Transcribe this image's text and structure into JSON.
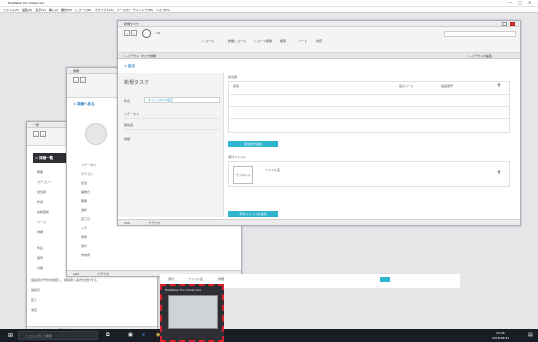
{
  "app": {
    "title": "FileMaker Pro Advanced",
    "window_controls": [
      "—",
      "□",
      "✕"
    ]
  },
  "menu": [
    "ファイル(F)",
    "編集(E)",
    "表示(V)",
    "挿入(I)",
    "書式(M)",
    "レコード(R)",
    "スクリプト(S)",
    "ツール(T)",
    "ウインドウ(W)",
    "ヘルプ(H)"
  ],
  "front": {
    "title": "新規タスク",
    "back": "< 戻る",
    "record_label": "1/1",
    "toolbar_items": [
      "レコード",
      "新規レコード",
      "レコード削除",
      "検索",
      "ソート",
      "共有"
    ],
    "fields": [
      {
        "label": "件名",
        "value": "オフィスWi-Fi設定"
      },
      {
        "label": "ステータス",
        "value": ""
      },
      {
        "label": "優先度",
        "value": ""
      },
      {
        "label": "詳細",
        "value": ""
      }
    ],
    "right_header": "担当者",
    "cols": [
      "名前",
      "電子メール",
      "電話番号"
    ],
    "add_person": "担当者を追加",
    "attach_header": "添付ファイル",
    "attach_thumb": "サムネイル",
    "file_name": "ファイル名",
    "add_file": "添付ファイルを追加",
    "zoom": "100",
    "mode": "ブラウズ",
    "layout_label": "レイアウト: タスク詳細",
    "layout_btn": "レイアウトの編集"
  },
  "mid": {
    "title": "詳細",
    "back": "< 詳細へ戻る",
    "items": [
      "ステータス",
      "カテゴリ",
      "担当",
      "開始日",
      "期限",
      "進捗",
      "完了日",
      "メモ",
      "場所",
      "添付",
      "作成者"
    ],
    "zoom": "100",
    "mode": "ブラウズ"
  },
  "back_win": {
    "title": "一覧",
    "back": "< 詳細一覧",
    "items": [
      "概要",
      "カテゴリー",
      "担当者",
      "作成",
      "最終更新",
      "ページ",
      "詳細",
      "件名",
      "番号",
      "分類",
      "優先度"
    ],
    "row_text": "会議室の予約を確認し、関係者へ案内を送付する",
    "row2": "最終日",
    "row3": "完了",
    "row4": "未定",
    "zoom": "100",
    "mode": "ブラウズ"
  },
  "lower_tabs": [
    "添付",
    "ファイル名",
    "詳細"
  ],
  "thumb_caption": "FileMaker Pro Advanced",
  "search": {
    "placeholder": "ここに入力して検索"
  },
  "tray": {
    "time": "19:06",
    "date": "2018/08/31"
  }
}
